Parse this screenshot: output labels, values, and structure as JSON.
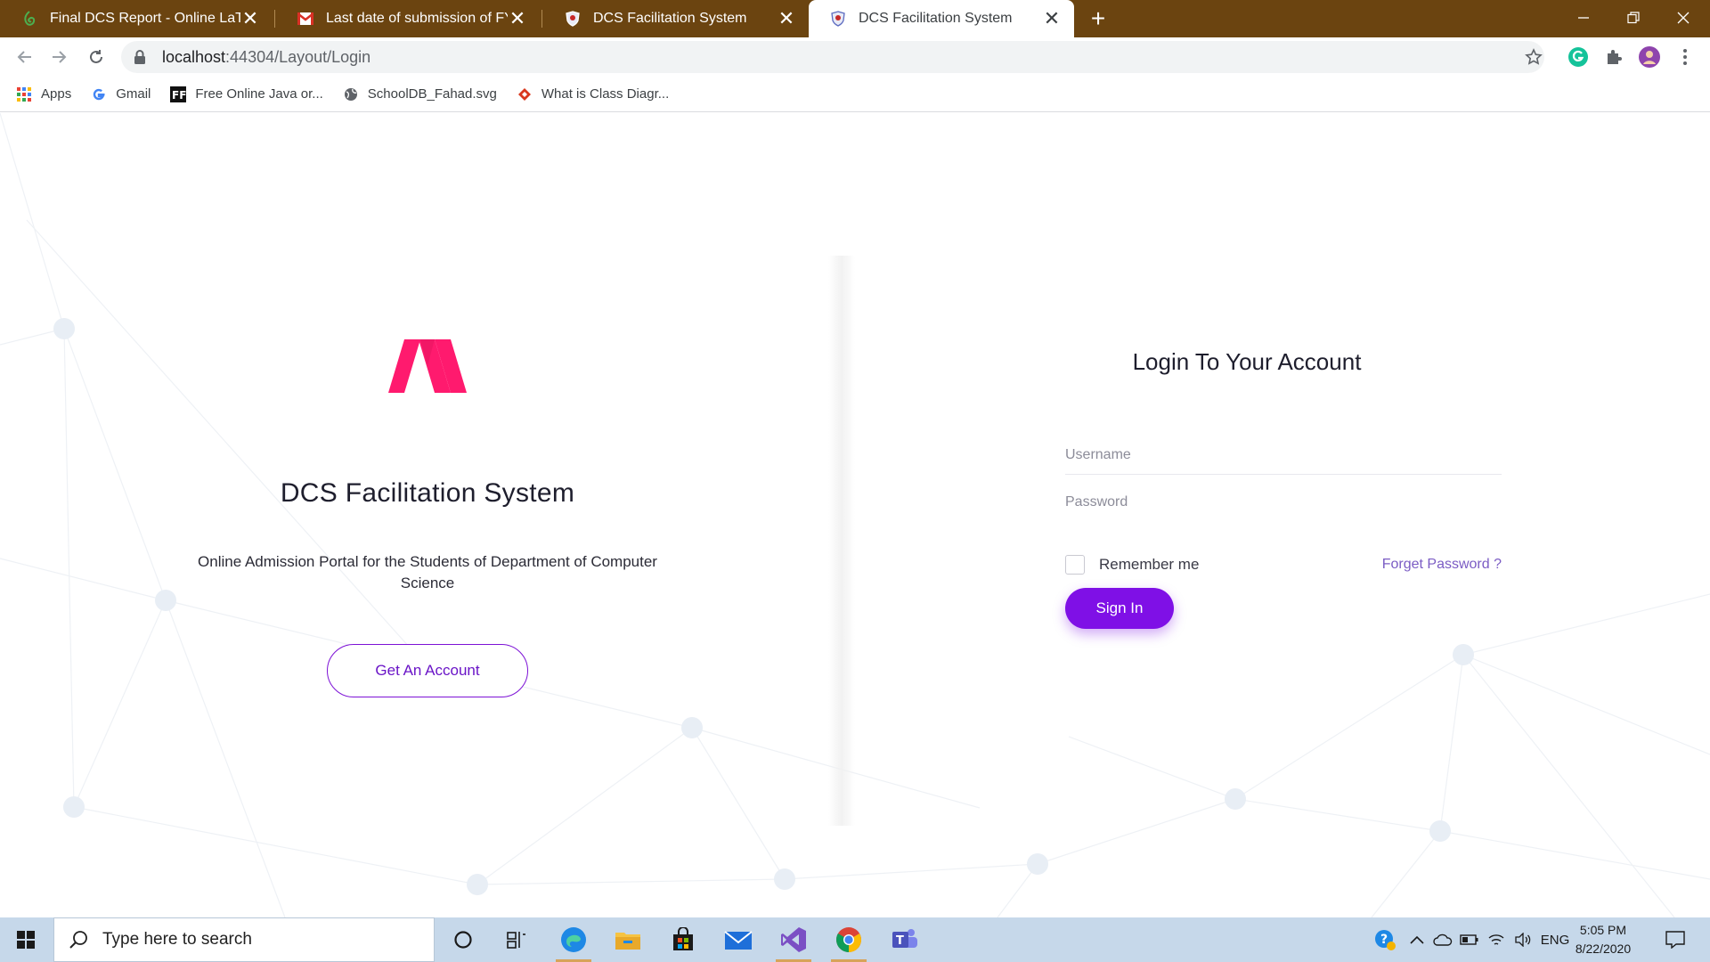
{
  "browser": {
    "tabs": [
      {
        "title": "Final DCS Report - Online LaTeX E",
        "icon": "overleaf-icon"
      },
      {
        "title": "Last date of submission of FYP fo",
        "icon": "gmail-icon"
      },
      {
        "title": "DCS Facilitation System",
        "icon": "shield-icon"
      },
      {
        "title": "DCS Facilitation System",
        "icon": "shield-icon",
        "active": true
      }
    ],
    "close_glyph": "✕",
    "new_tab_glyph": "+",
    "url_host": "localhost",
    "url_path": ":44304/Layout/Login",
    "bookmarks": [
      {
        "label": "Apps",
        "icon": "apps-grid-icon"
      },
      {
        "label": "Gmail",
        "icon": "google-icon"
      },
      {
        "label": "Free Online Java or...",
        "icon": "ff-icon"
      },
      {
        "label": "SchoolDB_Fahad.svg",
        "icon": "globe-icon"
      },
      {
        "label": "What is Class Diagr...",
        "icon": "diamond-icon"
      }
    ]
  },
  "left": {
    "app_title": "DCS Facilitation System",
    "description": "Online Admission Portal for the Students of Department of Computer Science",
    "get_account_label": "Get An Account"
  },
  "login": {
    "title": "Login To Your Account",
    "username_placeholder": "Username",
    "password_placeholder": "Password",
    "remember_label": "Remember me",
    "forget_label": "Forget Password ?",
    "signin_label": "Sign In"
  },
  "colors": {
    "accent": "#7f10e6",
    "logo": "#ff1a6e",
    "tabbar": "#6b4410"
  },
  "taskbar": {
    "search_placeholder": "Type here to search",
    "language": "ENG",
    "time": "5:05 PM",
    "date": "8/22/2020"
  }
}
